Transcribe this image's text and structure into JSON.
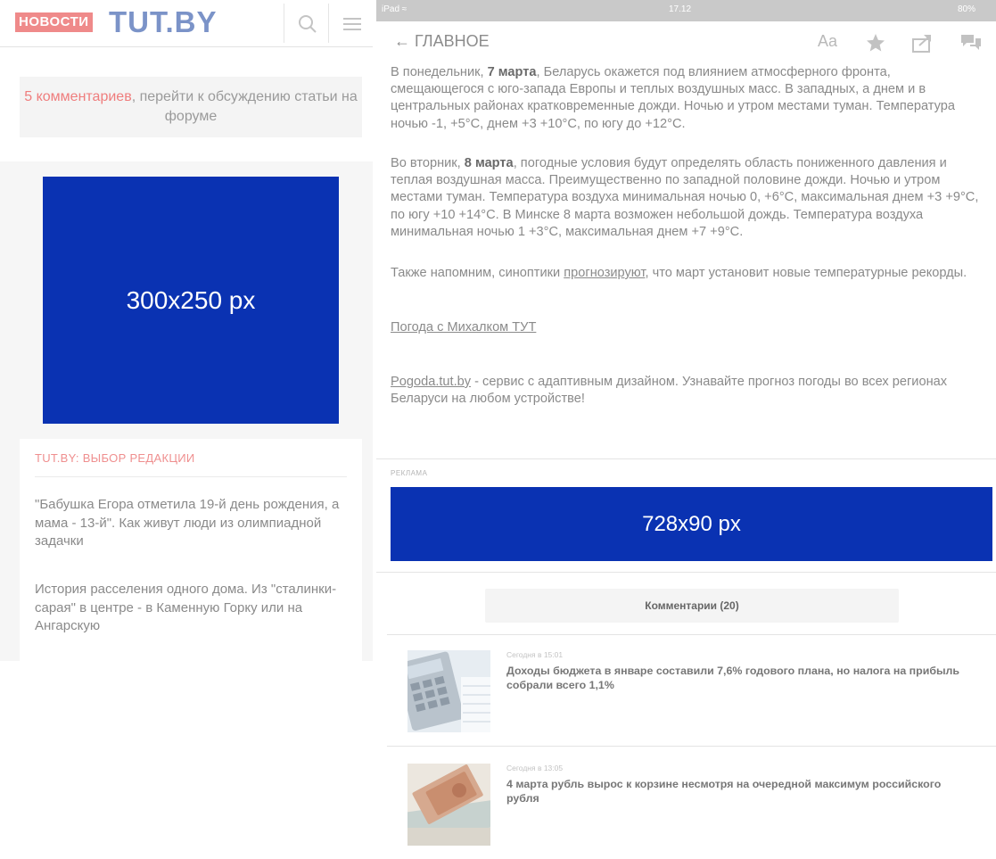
{
  "left": {
    "logo_badge": "НОВОСТИ",
    "logo_main": "TUT.BY",
    "comments_link": "5 комментариев",
    "comments_text": ", перейти к обсуждению статьи на форуме",
    "ad_label": "300x250 px",
    "editors_title": "TUT.BY: ВЫБОР РЕДАКЦИИ",
    "editors_items": [
      "\"Бабушка Егора отметила 19-й день рождения, а мама - 13-й\". Как живут люди из олимпиадной задачки",
      "История расселения одного дома. Из \"сталинки-сарая\" в центре - в Каменную Горку или на Ангарскую"
    ]
  },
  "right": {
    "status": {
      "device": "iPad",
      "time": "17.12",
      "battery": "80%"
    },
    "nav": {
      "back_label": "ГЛАВНОЕ",
      "font_label": "Aa"
    },
    "article": {
      "p1_pre": "В понедельник, ",
      "p1_bold": "7 марта",
      "p1_post": ", Беларусь окажется под влиянием атмосферного фронта, смещающегося с юго-запада Европы и теплых воздушных масс. В западных, а днем и в центральных районах кратковременные дожди. Ночью и утром местами туман. Температура ночью -1, +5°С, днем +3 +10°С, по югу до +12°С.",
      "p2_pre": "Во вторник, ",
      "p2_bold": "8 марта",
      "p2_post": ", погодные условия будут определять область пониженного давления и теплая воздушная масса. Преимущественно по западной половине дожди. Ночью и утром местами туман. Температура воздуха минимальная ночью 0, +6°С, максимальная днем +3 +9°С, по югу +10 +14°С. В Минске 8 марта возможен небольшой дождь. Температура воздуха минимальная ночью 1 +3°С, максимальная днем +7 +9°С.",
      "p3_pre": "Также напомним, синоптики ",
      "p3_link": "прогнозируют",
      "p3_post": ", что март установит новые температурные рекорды.",
      "p4_link": "Погода с Михалком ТУТ",
      "p5_link": "Pogoda.tut.by",
      "p5_post": " - сервис с адаптивным дизайном. Узнавайте прогноз погоды во всех регионах Беларуси на любом устройстве!"
    },
    "ad_caption": "РЕКЛАМА",
    "ad_label": "728x90 px",
    "comments_button": "Комментарии (20)",
    "news": [
      {
        "time": "Сегодня в 15:01",
        "title": "Доходы бюджета в январе составили 7,6% годового плана, но налога на прибыль собрали всего 1,1%"
      },
      {
        "time": "Сегодня в 13:05",
        "title": "4 марта рубль вырос к корзине несмотря на очередной максимум российского рубля"
      }
    ]
  }
}
